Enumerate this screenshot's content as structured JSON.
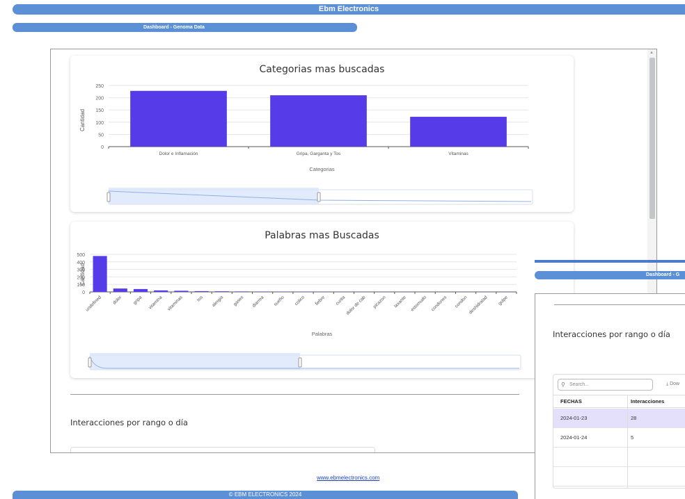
{
  "header": {
    "title": "Ebm Electronics",
    "subtitle": "Dashboard - Genoma Data",
    "subtitle_cut": "Dashboard - G"
  },
  "footer": {
    "link": "www.ebmelectronics.com",
    "copyright": "© EBM ELECTRONICS 2024"
  },
  "colors": {
    "bar": "#553ce8",
    "banner": "#5b8fd6",
    "navigator": "#d8e4fb",
    "selected_row": "#e4e0fb"
  },
  "charts": {
    "c1": {
      "title": "Categorias mas buscadas",
      "ylabel": "Cantidad",
      "xlabel": "Categorias"
    },
    "c2": {
      "title": "Palabras mas Buscadas",
      "ylabel": "Cantidad",
      "xlabel": "Palabras"
    }
  },
  "chart_data": [
    {
      "type": "bar",
      "title": "Categorias mas buscadas",
      "xlabel": "Categorias",
      "ylabel": "Cantidad",
      "ylim": [
        0,
        250
      ],
      "yticks": [
        0,
        50,
        100,
        150,
        200,
        250
      ],
      "categories": [
        "Dolor e Inflamación",
        "Gripa, Garganta y Tos",
        "Vitaminas"
      ],
      "values": [
        228,
        210,
        122
      ]
    },
    {
      "type": "bar",
      "title": "Palabras mas Buscadas",
      "xlabel": "Palabras",
      "ylabel": "Cantidad",
      "ylim": [
        0,
        500
      ],
      "yticks": [
        0,
        100,
        200,
        300,
        400,
        500
      ],
      "categories": [
        "undefined",
        "dolor",
        "gripa",
        "vitamina",
        "vitaminas",
        "tos",
        "alergia",
        "gases",
        "diarrea",
        "sueño",
        "colico",
        "fiebre",
        "curita",
        "dolor de cab",
        "picazon",
        "laxante",
        "estomudo",
        "condones",
        "condon",
        "deshidratad",
        "golpe"
      ],
      "values": [
        478,
        45,
        38,
        20,
        15,
        10,
        8,
        6,
        5,
        4,
        4,
        3,
        3,
        3,
        2,
        2,
        2,
        2,
        2,
        2,
        2
      ]
    }
  ],
  "section": {
    "title": "Interacciones por rango o día"
  },
  "grid": {
    "search_placeholder": "Search...",
    "download_label": "Dow",
    "columns": [
      "FECHAS",
      "Interacciones"
    ],
    "rows": [
      {
        "fecha": "2024-01-23",
        "interacciones": "28"
      },
      {
        "fecha": "2024-01-24",
        "interacciones": "5"
      }
    ]
  }
}
